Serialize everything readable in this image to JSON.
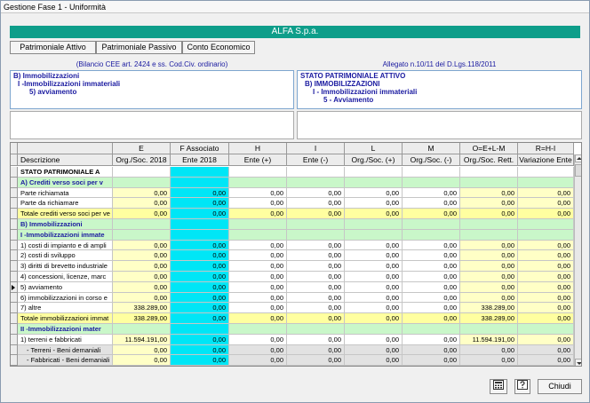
{
  "window": {
    "title": "Gestione Fase 1 - Uniformità"
  },
  "header": {
    "company": "ALFA S.p.a."
  },
  "tabs": [
    "Patrimoniale Attivo",
    "Patrimoniale Passivo",
    "Conto Economico"
  ],
  "left_panel": {
    "title": "(Bilancio CEE art. 2424 e ss. Cod.Civ. ordinario)",
    "lines": [
      "B) Immobilizzazioni",
      "I -Immobilizzazioni immateriali",
      "5) avviamento"
    ]
  },
  "right_panel": {
    "title": "Allegato n.10/11 del D.Lgs.118/2011",
    "lines": [
      "STATO PATRIMONIALE ATTIVO",
      "B) IMMOBILIZZAZIONI",
      "I - Immobilizzazioni immateriali",
      "5 - Avviamento"
    ]
  },
  "grid": {
    "letters": [
      "",
      "E",
      "F Associato",
      "H",
      "I",
      "L",
      "M",
      "O=E+L-M",
      "R=H-I"
    ],
    "headers": [
      "Descrizione",
      "Org./Soc. 2018",
      "Ente 2018",
      "Ente (+)",
      "Ente (-)",
      "Org./Soc. (+)",
      "Org./Soc. (-)",
      "Org./Soc. Rett.",
      "Variazione Ente"
    ],
    "rows": [
      {
        "desc": "STATO PATRIMONIALE A",
        "type": "section",
        "values": [
          "",
          "",
          "",
          "",
          "",
          "",
          "",
          ""
        ]
      },
      {
        "desc": "A) Crediti verso soci per v",
        "type": "group",
        "values": [
          "",
          "",
          "",
          "",
          "",
          "",
          "",
          ""
        ]
      },
      {
        "desc": "Parte richiamata",
        "type": "item",
        "values": [
          "0,00",
          "0,00",
          "0,00",
          "0,00",
          "0,00",
          "0,00",
          "0,00",
          "0,00"
        ]
      },
      {
        "desc": "Parte da richiamare",
        "type": "item",
        "values": [
          "0,00",
          "0,00",
          "0,00",
          "0,00",
          "0,00",
          "0,00",
          "0,00",
          "0,00"
        ]
      },
      {
        "desc": "Totale crediti verso soci per ve",
        "type": "total",
        "values": [
          "0,00",
          "0,00",
          "0,00",
          "0,00",
          "0,00",
          "0,00",
          "0,00",
          "0,00"
        ]
      },
      {
        "desc": "B) Immobilizzazioni",
        "type": "group",
        "values": [
          "",
          "",
          "",
          "",
          "",
          "",
          "",
          ""
        ]
      },
      {
        "desc": "I -Immobilizzazioni immate",
        "type": "group",
        "values": [
          "",
          "",
          "",
          "",
          "",
          "",
          "",
          ""
        ]
      },
      {
        "desc": "1) costi di impianto e di ampli",
        "type": "item",
        "values": [
          "0,00",
          "0,00",
          "0,00",
          "0,00",
          "0,00",
          "0,00",
          "0,00",
          "0,00"
        ]
      },
      {
        "desc": "2) costi di sviluppo",
        "type": "item",
        "values": [
          "0,00",
          "0,00",
          "0,00",
          "0,00",
          "0,00",
          "0,00",
          "0,00",
          "0,00"
        ]
      },
      {
        "desc": "3) diritti di brevetto industriale",
        "type": "item",
        "values": [
          "0,00",
          "0,00",
          "0,00",
          "0,00",
          "0,00",
          "0,00",
          "0,00",
          "0,00"
        ]
      },
      {
        "desc": "4) concessioni, licenze, marc",
        "type": "item",
        "values": [
          "0,00",
          "0,00",
          "0,00",
          "0,00",
          "0,00",
          "0,00",
          "0,00",
          "0,00"
        ]
      },
      {
        "desc": "5) avviamento",
        "type": "item",
        "current": true,
        "values": [
          "0,00",
          "0,00",
          "0,00",
          "0,00",
          "0,00",
          "0,00",
          "0,00",
          "0,00"
        ]
      },
      {
        "desc": "6) immobilizzazioni in corso e",
        "type": "item",
        "values": [
          "0,00",
          "0,00",
          "0,00",
          "0,00",
          "0,00",
          "0,00",
          "0,00",
          "0,00"
        ]
      },
      {
        "desc": "7) altre",
        "type": "item",
        "values": [
          "338.289,00",
          "0,00",
          "0,00",
          "0,00",
          "0,00",
          "0,00",
          "338.289,00",
          "0,00"
        ]
      },
      {
        "desc": "Totale immobilizzazioni immat",
        "type": "total",
        "values": [
          "338.289,00",
          "0,00",
          "0,00",
          "0,00",
          "0,00",
          "0,00",
          "338.289,00",
          "0,00"
        ]
      },
      {
        "desc": "II -Immobilizzazioni mater",
        "type": "group",
        "values": [
          "",
          "",
          "",
          "",
          "",
          "",
          "",
          ""
        ]
      },
      {
        "desc": "1) terreni e fabbricati",
        "type": "item",
        "values": [
          "11.594.191,00",
          "0,00",
          "0,00",
          "0,00",
          "0,00",
          "0,00",
          "11.594.191,00",
          "0,00"
        ]
      },
      {
        "desc": "- Terreni - Beni demaniali",
        "type": "sub",
        "values": [
          "0,00",
          "0,00",
          "0,00",
          "0,00",
          "0,00",
          "0,00",
          "0,00",
          "0,00"
        ]
      },
      {
        "desc": "- Fabbricati - Beni demaniali",
        "type": "sub",
        "values": [
          "0,00",
          "0,00",
          "0,00",
          "0,00",
          "0,00",
          "0,00",
          "0,00",
          "0,00"
        ]
      }
    ]
  },
  "footer": {
    "close_label": "Chiudi",
    "icons": [
      "calculator-icon",
      "help-icon"
    ]
  },
  "colors": {
    "header": "#0e9e8a",
    "section": "#c9f7c9",
    "editable": "#ffffc6",
    "associated": "#00e6f6",
    "total": "#ffffa0",
    "sub": "#e2e2e2"
  }
}
